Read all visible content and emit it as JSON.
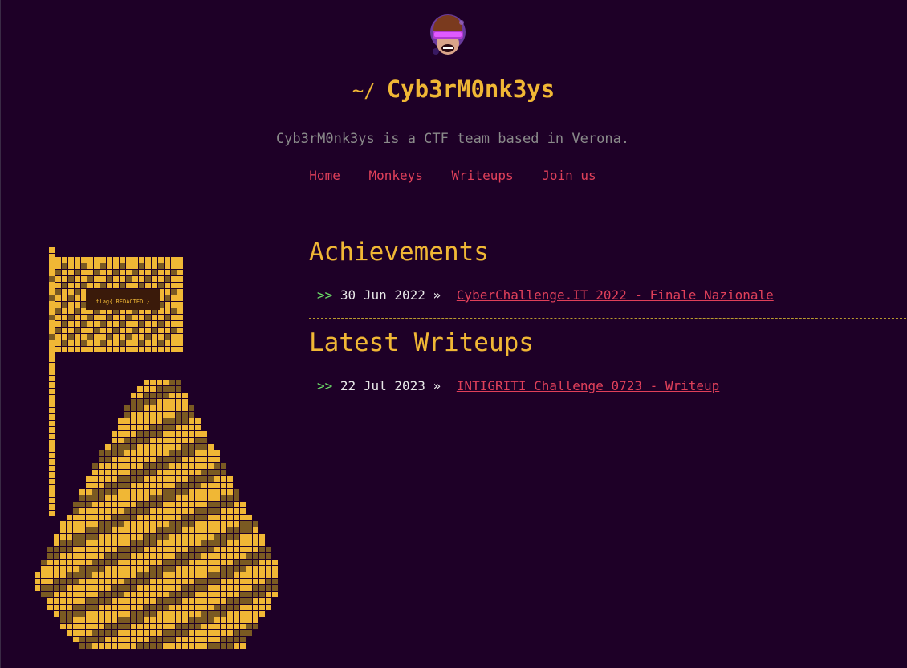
{
  "header": {
    "prompt": "~/",
    "title": "Cyb3rM0nk3ys",
    "tagline": "Cyb3rM0nk3ys is a CTF team based in Verona."
  },
  "nav": {
    "items": [
      "Home",
      "Monkeys",
      "Writeups",
      "Join us"
    ]
  },
  "art": {
    "flag_text": "flag{ REDACTED }"
  },
  "achievements": {
    "title": "Achievements",
    "entries": [
      {
        "arrows": ">>",
        "date": "30 Jun 2022",
        "sep": "»",
        "link": "CyberChallenge.IT 2022 - Finale Nazionale"
      }
    ]
  },
  "writeups": {
    "title": "Latest Writeups",
    "entries": [
      {
        "arrows": ">>",
        "date": "22 Jul 2023",
        "sep": "»",
        "link": "INTIGRITI Challenge 0723 - Writeup"
      }
    ]
  },
  "colors": {
    "background": "#1e0027",
    "accent": "#f0b735",
    "link": "#e0405a",
    "arrow": "#6fe36a"
  }
}
